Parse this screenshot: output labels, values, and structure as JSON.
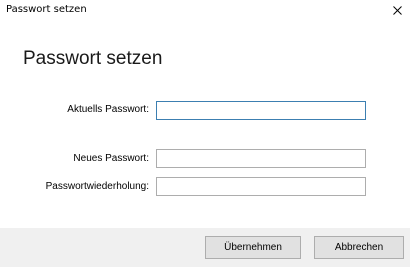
{
  "window": {
    "title": "Passwort setzen"
  },
  "dialog": {
    "heading": "Passwort setzen"
  },
  "form": {
    "current_password": {
      "label": "Aktuells Passwort:",
      "value": ""
    },
    "new_password": {
      "label": "Neues Passwort:",
      "value": ""
    },
    "repeat_password": {
      "label": "Passwortwiederholung:",
      "value": ""
    }
  },
  "footer": {
    "apply_label": "Übernehmen",
    "cancel_label": "Abbrechen"
  },
  "icons": {
    "close": "close-icon"
  },
  "colors": {
    "focus_border": "#3c7fb1",
    "footer_bg": "#f0f0f0",
    "button_bg": "#e1e1e1"
  }
}
